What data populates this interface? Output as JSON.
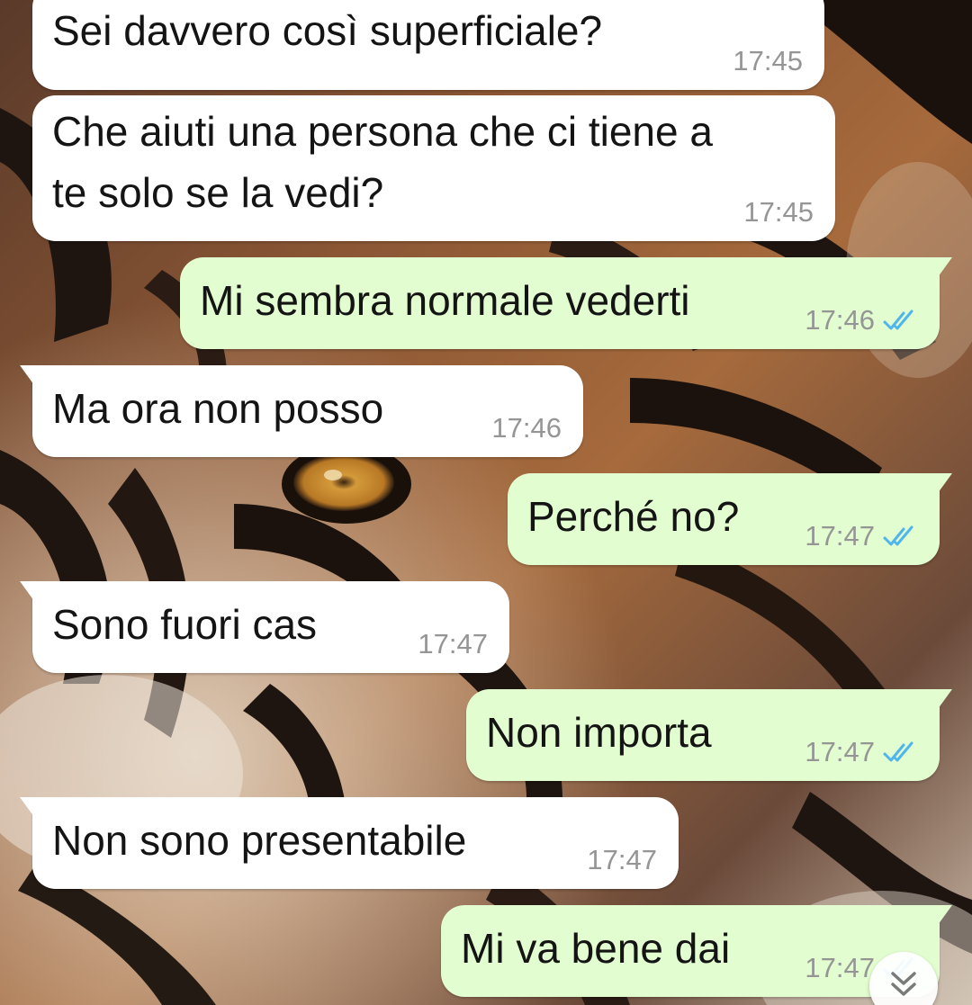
{
  "chat": {
    "messages": [
      {
        "direction": "incoming",
        "text": "Sei davvero così superficiale?",
        "time": "17:45"
      },
      {
        "direction": "incoming",
        "text": "Che aiuti una persona che ci tiene a",
        "text2": "te solo se la vedi?",
        "time": "17:45"
      },
      {
        "direction": "outgoing",
        "text": "Mi sembra normale vederti",
        "time": "17:46",
        "status": "read"
      },
      {
        "direction": "incoming",
        "text": "Ma ora non posso",
        "time": "17:46"
      },
      {
        "direction": "outgoing",
        "text": "Perché no?",
        "time": "17:47",
        "status": "read"
      },
      {
        "direction": "incoming",
        "text": "Sono fuori cas",
        "time": "17:47"
      },
      {
        "direction": "outgoing",
        "text": "Non importa",
        "time": "17:47",
        "status": "read"
      },
      {
        "direction": "incoming",
        "text": "Non sono presentabile",
        "time": "17:47"
      },
      {
        "direction": "outgoing",
        "text": "Mi va bene dai",
        "time": "17:47",
        "status": "read"
      }
    ]
  },
  "icons": {
    "read_receipt": "double-check-icon",
    "scroll_down": "double-chevron-down-icon"
  },
  "colors": {
    "incoming_bubble": "#ffffff",
    "outgoing_bubble": "#e2fdd0",
    "text": "#141414",
    "timestamp": "#959595",
    "read_ticks": "#4fb6ec",
    "wallpaper_fur": "#9a5a2e",
    "wallpaper_eye": "#d49a3a"
  }
}
